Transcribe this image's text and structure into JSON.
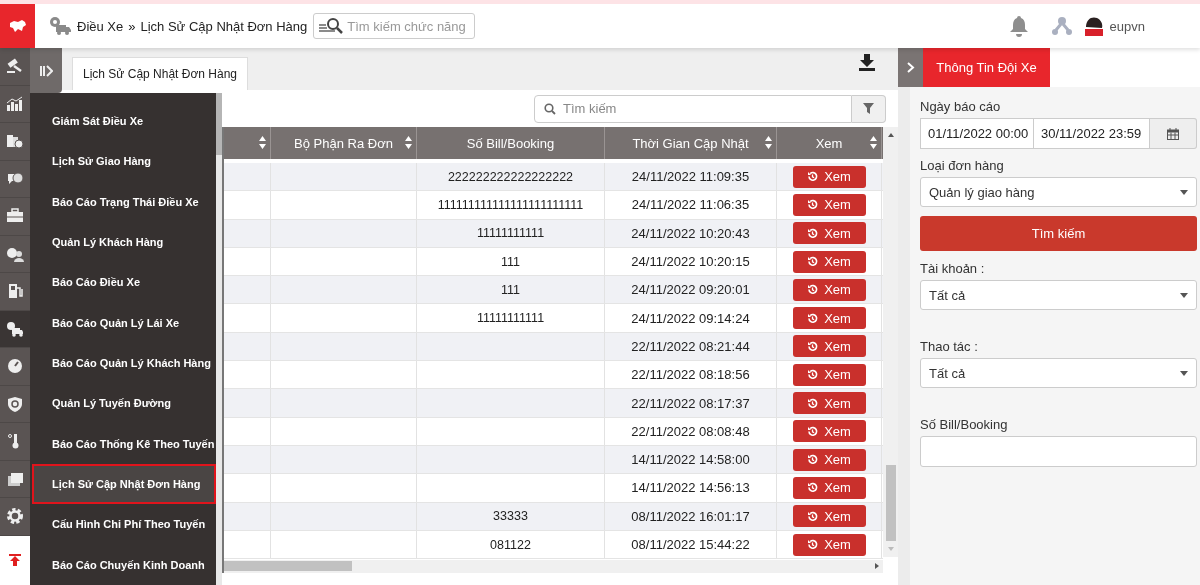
{
  "header": {
    "breadcrumb": [
      "Điều Xe",
      "Lịch Sử Cập Nhật Đơn Hàng"
    ],
    "separator": "»",
    "search_placeholder": "Tìm kiếm chức năng",
    "username": "eupvn"
  },
  "rail": [
    {
      "kind": "gavel",
      "selected": false
    },
    {
      "kind": "chart",
      "selected": false
    },
    {
      "kind": "boxes",
      "selected": false
    },
    {
      "kind": "chat",
      "selected": false
    },
    {
      "kind": "briefcase",
      "selected": false
    },
    {
      "kind": "money",
      "selected": false
    },
    {
      "kind": "fuel",
      "selected": false
    },
    {
      "kind": "truck",
      "selected": true
    },
    {
      "kind": "gauge",
      "selected": false
    },
    {
      "kind": "shield",
      "selected": false
    },
    {
      "kind": "thermometer",
      "selected": false
    },
    {
      "kind": "documents",
      "selected": false
    },
    {
      "kind": "gear",
      "selected": false
    }
  ],
  "tabs": [
    {
      "label": "Lịch Sử Cập Nhật Đơn Hàng",
      "selected": true
    }
  ],
  "menu": [
    {
      "label": "Giám Sát Điều Xe",
      "selected": false
    },
    {
      "label": "Lịch Sử Giao Hàng",
      "selected": false
    },
    {
      "label": "Báo Cáo Trạng Thái Điều Xe",
      "selected": false
    },
    {
      "label": "Quản Lý Khách Hàng",
      "selected": false
    },
    {
      "label": "Báo Cáo Điều Xe",
      "selected": false
    },
    {
      "label": "Báo Cáo Quản Lý Lái Xe",
      "selected": false
    },
    {
      "label": "Báo Cáo Quản Lý Khách Hàng",
      "selected": false
    },
    {
      "label": "Quản Lý Tuyến Đường",
      "selected": false
    },
    {
      "label": "Báo Cáo Thống Kê Theo Tuyến",
      "selected": false
    },
    {
      "label": "Lịch Sử Cập Nhật Đơn Hàng",
      "selected": true
    },
    {
      "label": "Cấu Hình Chi Phí Theo Tuyến",
      "selected": false
    },
    {
      "label": "Báo Cáo Chuyến Kinh Doanh",
      "selected": false
    }
  ],
  "table": {
    "search_placeholder": "Tìm kiếm",
    "columns": [
      {
        "label": "Bộ Phận Ra Đơn",
        "sortable": true
      },
      {
        "label": "Số Bill/Booking",
        "sortable": false
      },
      {
        "label": "Thời Gian Cập Nhật",
        "sortable": true
      },
      {
        "label": "Xem",
        "sortable": true
      }
    ],
    "rows": [
      {
        "bill": "222222222222222222",
        "time": "24/11/2022 11:09:35",
        "action": "Xem"
      },
      {
        "bill": "111111111111111111111111",
        "time": "24/11/2022 11:06:35",
        "action": "Xem"
      },
      {
        "bill": "11111111111",
        "time": "24/11/2022 10:20:43",
        "action": "Xem"
      },
      {
        "bill": "111",
        "time": "24/11/2022 10:20:15",
        "action": "Xem"
      },
      {
        "bill": "111",
        "time": "24/11/2022 09:20:01",
        "action": "Xem"
      },
      {
        "bill": "11111111111",
        "time": "24/11/2022 09:14:24",
        "action": "Xem"
      },
      {
        "time": "22/11/2022 08:21:44",
        "action": "Xem"
      },
      {
        "time": "22/11/2022 08:18:56",
        "action": "Xem"
      },
      {
        "time": "22/11/2022 08:17:37",
        "action": "Xem"
      },
      {
        "time": "22/11/2022 08:08:48",
        "action": "Xem"
      },
      {
        "time": "14/11/2022 14:58:00",
        "action": "Xem"
      },
      {
        "time": "14/11/2022 14:56:13",
        "action": "Xem"
      },
      {
        "bill": "33333",
        "time": "08/11/2022 16:01:17",
        "action": "Xem"
      },
      {
        "bill": "081122",
        "time": "08/11/2022 15:44:22",
        "action": "Xem"
      }
    ]
  },
  "panel": {
    "tab": "Thông Tin Đội Xe",
    "fields": [
      {
        "kind": "daterange",
        "label": "Ngày báo cáo",
        "from": "01/11/2022 00:00",
        "to": "30/11/2022 23:59"
      },
      {
        "kind": "select",
        "label": "Loại đơn hàng",
        "value": "Quản lý giao hàng"
      },
      {
        "kind": "button",
        "label": "Tìm kiếm"
      },
      {
        "kind": "select",
        "label": "Tài khoản :",
        "value": "Tất cả"
      },
      {
        "kind": "select",
        "label": "Thao tác :",
        "value": "Tất cả"
      },
      {
        "kind": "text",
        "label": "Số Bill/Booking"
      }
    ]
  }
}
